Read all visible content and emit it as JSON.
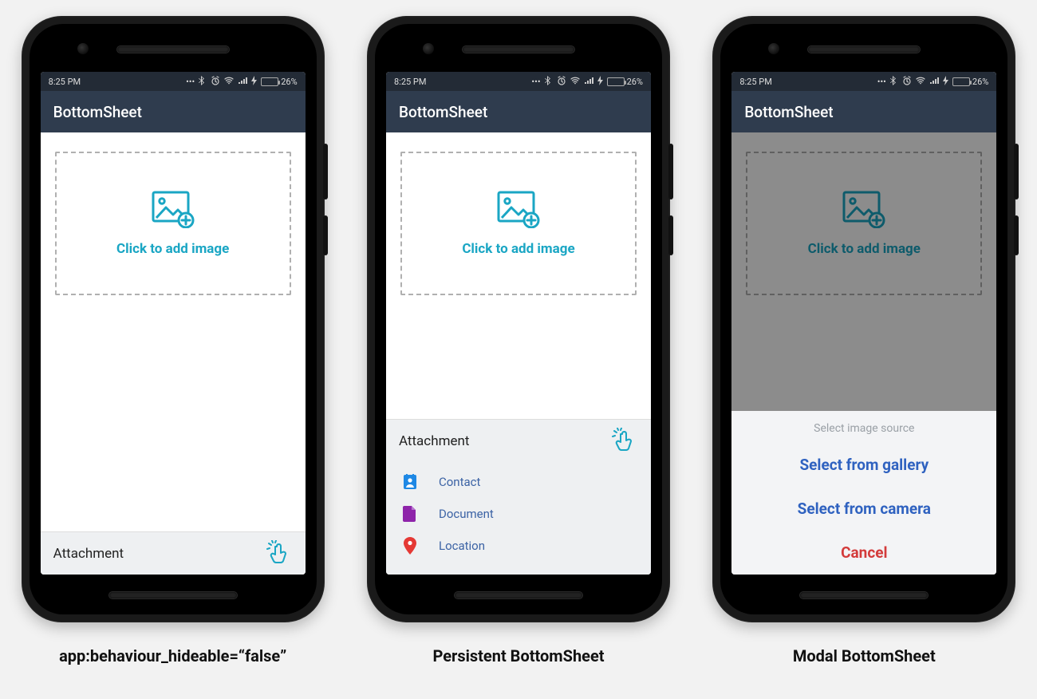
{
  "status": {
    "time": "8:25 PM",
    "battery_pct": "26%"
  },
  "appbar": {
    "title": "BottomSheet"
  },
  "dropzone": {
    "label": "Click to add image"
  },
  "sheet": {
    "title": "Attachment",
    "items": [
      {
        "label": "Contact",
        "icon": "contact-icon",
        "icon_color": "#1e88e5"
      },
      {
        "label": "Document",
        "icon": "document-icon",
        "icon_color": "#8e24aa"
      },
      {
        "label": "Location",
        "icon": "location-icon",
        "icon_color": "#e53935"
      }
    ]
  },
  "modal": {
    "title": "Select image source",
    "items": [
      {
        "label": "Select from gallery"
      },
      {
        "label": "Select from camera"
      }
    ],
    "cancel": "Cancel"
  },
  "captions": {
    "c1": "app:behaviour_hideable=“false”",
    "c2": "Persistent BottomSheet",
    "c3": "Modal BottomSheet"
  },
  "colors": {
    "accent": "#1aa6c4",
    "appbar": "#2f3c4e",
    "statusbar": "#232b36",
    "sheet_bg": "#eef0f2",
    "link": "#3c63a5"
  }
}
